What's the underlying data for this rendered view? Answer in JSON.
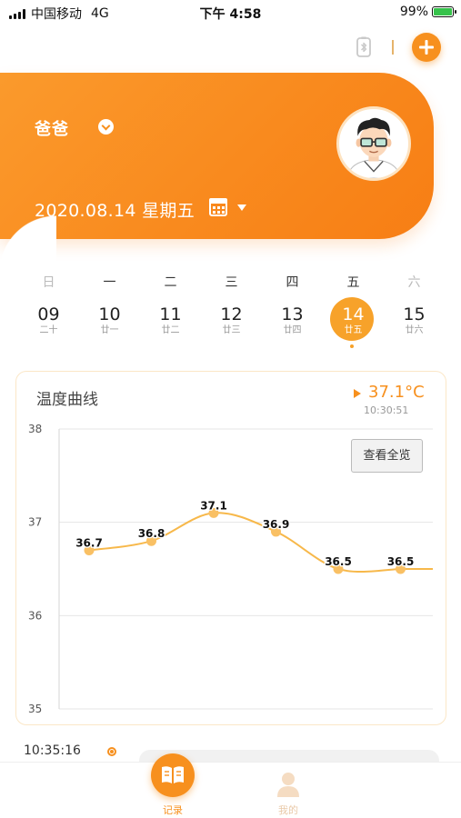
{
  "status_bar": {
    "carrier": "中国移动",
    "network": "4G",
    "time": "下午 4:58",
    "battery_percent": "99%",
    "battery_level": 0.99
  },
  "header": {
    "person_name": "爸爸",
    "date": "2020.08.14 星期五"
  },
  "week": {
    "days": [
      {
        "weekday": "日",
        "day": "09",
        "lunar": "二十"
      },
      {
        "weekday": "一",
        "day": "10",
        "lunar": "廿一"
      },
      {
        "weekday": "二",
        "day": "11",
        "lunar": "廿二"
      },
      {
        "weekday": "三",
        "day": "12",
        "lunar": "廿三"
      },
      {
        "weekday": "四",
        "day": "13",
        "lunar": "廿四"
      },
      {
        "weekday": "五",
        "day": "14",
        "lunar": "廿五"
      },
      {
        "weekday": "六",
        "day": "15",
        "lunar": "廿六"
      }
    ],
    "selected_index": 5
  },
  "chart_card": {
    "title": "温度曲线",
    "current_temp": "37.1°C",
    "current_time": "10:30:51",
    "view_all_label": "查看全览"
  },
  "chart_data": {
    "type": "line",
    "title": "",
    "xlabel": "",
    "ylabel": "",
    "ylim": [
      35,
      38
    ],
    "yticks": [
      35,
      36,
      37,
      38
    ],
    "grid": true,
    "line_color": "#f7b84a",
    "point_color": "#f9c064",
    "series": [
      {
        "values": [
          36.7,
          36.8,
          37.1,
          36.9,
          36.5,
          36.5
        ]
      }
    ],
    "data_labels": [
      "36.7",
      "36.8",
      "37.1",
      "36.9",
      "36.5",
      "36.5"
    ]
  },
  "record": {
    "time": "10:35:16"
  },
  "tab_bar": {
    "record_label": "记录",
    "mine_label": "我的"
  },
  "colors": {
    "accent": "#f7901e",
    "accent_light": "#f7a22a"
  }
}
